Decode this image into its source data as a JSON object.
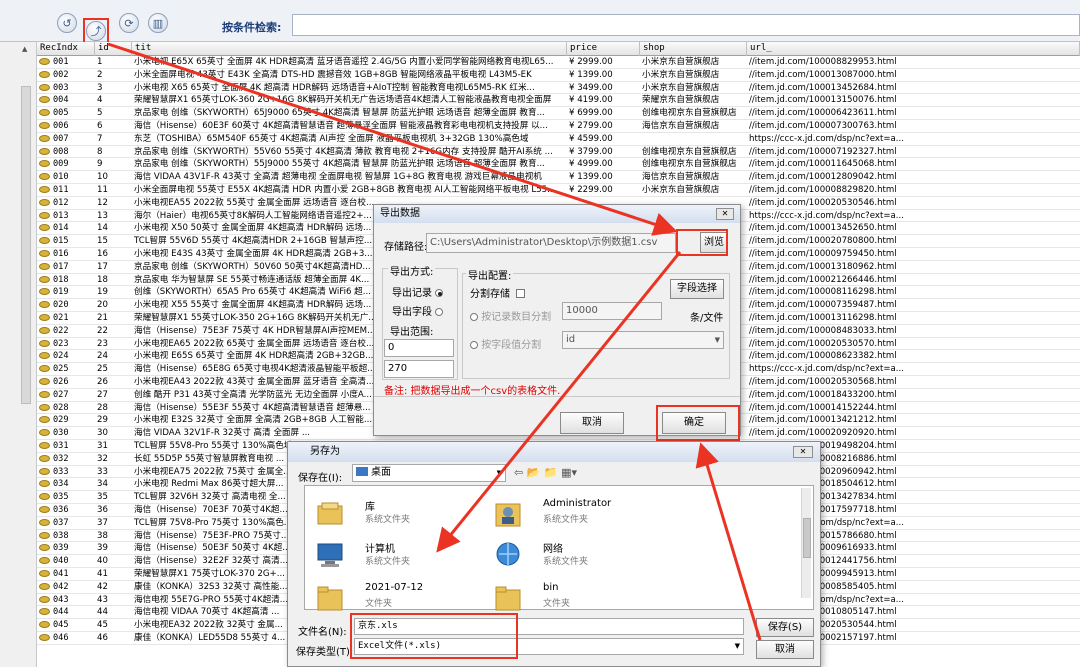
{
  "toolbar": {
    "icons": [
      "undo-icon",
      "export-icon",
      "refresh-icon",
      "delete-icon"
    ],
    "search_label": "按条件检索:",
    "search_value": ""
  },
  "grid": {
    "columns": [
      "RecIndx",
      "id",
      "tit",
      "price",
      "shop",
      "url_"
    ],
    "rows": [
      [
        "001",
        "1",
        "小米电视 E65X 65英寸 全面屏 4K HDR超高清 蓝牙语音遥控 2.4G/5G 内置小爱同学智能网络教育电视L65...",
        "¥ 2999.00",
        "小米京东自营旗舰店",
        "//item.jd.com/100008829953.html"
      ],
      [
        "002",
        "2",
        "小米全面屏电视 43英寸 E43K 全高清 DTS-HD 震撼音效 1GB+8GB 智能网络液晶平板电视 L43M5-EK",
        "¥ 1399.00",
        "小米京东自营旗舰店",
        "//item.jd.com/100013087000.html"
      ],
      [
        "003",
        "3",
        "小米电视 X65 65英寸 全面屏 4K 超高清 HDR解码 远场语音+AIoT控制 智能教育电视L65M5-RK 红米...",
        "¥ 3499.00",
        "小米京东自营旗舰店",
        "//item.jd.com/100013452684.html"
      ],
      [
        "004",
        "4",
        "荣耀智慧屏X1 65英寸LOK-360 2G+16G 8K解码开关机无广告远场语音4K超清人工智能液晶教育电视全面屏",
        "¥ 4199.00",
        "荣耀京东自营旗舰店",
        "//item.jd.com/100013150076.html"
      ],
      [
        "005",
        "5",
        "京品家电 创维（SKYWORTH）65J9000 65英寸 4K超高清 智慧屏 防蓝光护眼 远场语音 超薄全面屏 教育...",
        "¥ 6999.00",
        "创维电视京东自营旗舰店",
        "//item.jd.com/100006423611.html"
      ],
      [
        "006",
        "6",
        "海信（Hisense）60E3F 60英寸 4K超高清智慧语音 超薄悬浮全面屏 智能液晶教育彩电电视机支持投屏 以...",
        "¥ 2799.00",
        "海信京东自营旗舰店",
        "//item.jd.com/100007300763.html"
      ],
      [
        "007",
        "7",
        "东芝（TOSHIBA）65M540F 65英寸 4K超高清 AI声控 全面屏 液晶平板电视机 3+32GB 130%高色域",
        "¥ 4599.00",
        "",
        "https://ccc-x.jd.com/dsp/nc?ext=a..."
      ],
      [
        "008",
        "8",
        "京品家电 创维（SKYWORTH）55V60 55英寸 4K超高清 薄款 教育电视 2+16G内存 支持投屏 酷开AI系统 ...",
        "¥ 3799.00",
        "创维电视京东自营旗舰店",
        "//item.jd.com/100007192327.html"
      ],
      [
        "009",
        "9",
        "京品家电 创维（SKYWORTH）55J9000 55英寸 4K超高清 智慧屏 防蓝光护眼 远场语音 超薄全面屏 教育...",
        "¥ 4999.00",
        "创维电视京东自营旗舰店",
        "//item.jd.com/100011645068.html"
      ],
      [
        "010",
        "10",
        "海信 VIDAA 43V1F-R 43英寸 全高清 超薄电视 全面屏电视 智慧屏 1G+8G 教育电视 游戏巨幕液晶电视机",
        "¥ 1399.00",
        "海信京东自营旗舰店",
        "//item.jd.com/100012809042.html"
      ],
      [
        "011",
        "11",
        "小米全面屏电视 55英寸 E55X 4K超高清 HDR 内置小爱 2GB+8GB 教育电视 AI人工智能网络平板电视 L55...",
        "¥ 2299.00",
        "小米京东自营旗舰店",
        "//item.jd.com/100008829820.html"
      ],
      [
        "012",
        "12",
        "小米电视EA55 2022款 55英寸 金属全面屏 远场语音 逐台校...",
        "",
        "",
        "//item.jd.com/100020530546.html"
      ],
      [
        "013",
        "13",
        "海尔（Haier）电视65英寸8K解码人工智能网络语音遥控2+...",
        "",
        "",
        "https://ccc-x.jd.com/dsp/nc?ext=a..."
      ],
      [
        "014",
        "14",
        "小米电视 X50 50英寸 金属全面屏 4K超高清 HDR解码 远场...",
        "",
        "",
        "//item.jd.com/100013452650.html"
      ],
      [
        "015",
        "15",
        "TCL智屏 55V6D 55英寸 4K超高清HDR 2+16GB 智慧声控...",
        "",
        "",
        "//item.jd.com/100020780800.html"
      ],
      [
        "016",
        "16",
        "小米电视 E43S 43英寸 金属全面屏 4K HDR超高清 2GB+3...",
        "",
        "",
        "//item.jd.com/100009759450.html"
      ],
      [
        "017",
        "17",
        "京品家电 创维（SKYWORTH）50V60 50英寸4K超高清HD...",
        "",
        "",
        "//item.jd.com/100013180962.html"
      ],
      [
        "018",
        "18",
        "京品家电 华为智慧屏 SE 55英寸畅连通话版 超薄全面屏 4K...",
        "",
        "",
        "//item.jd.com/100021266446.html"
      ],
      [
        "019",
        "19",
        "创维（SKYWORTH）65A5 Pro 65英寸 4K超高清 WiFi6 超...",
        "",
        "",
        "//item.jd.com/100008116298.html"
      ],
      [
        "020",
        "20",
        "小米电视 X55 55英寸 金属全面屏 4K超高清 HDR解码 远场...",
        "",
        "",
        "//item.jd.com/100007359487.html"
      ],
      [
        "021",
        "21",
        "荣耀智慧屏X1 55英寸LOK-350 2G+16G 8K解码开关机无广...",
        "",
        "",
        "//item.jd.com/100013116298.html"
      ],
      [
        "022",
        "22",
        "海信（Hisense）75E3F 75英寸 4K HDR智慧屏AI声控MEM...",
        "",
        "",
        "//item.jd.com/100008483033.html"
      ],
      [
        "023",
        "23",
        "小米电视EA65 2022款 65英寸 金属全面屏 远场语音 逐台校...",
        "",
        "",
        "//item.jd.com/100020530570.html"
      ],
      [
        "024",
        "24",
        "小米电视 E65S 65英寸 全面屏 4K HDR超高清 2GB+32GB...",
        "",
        "",
        "//item.jd.com/100008623382.html"
      ],
      [
        "025",
        "25",
        "海信（Hisense）65E8G 65英寸电视4K超清液晶智能平板超...",
        "",
        "",
        "https://ccc-x.jd.com/dsp/nc?ext=a..."
      ],
      [
        "026",
        "26",
        "小米电视EA43 2022款 43英寸 金属全面屏 蓝牙语音 全高清...",
        "",
        "",
        "//item.jd.com/100020530568.html"
      ],
      [
        "027",
        "27",
        "创维 酷开 P31 43英寸全高清 光学防蓝光 无边全面屏 小度A...",
        "",
        "",
        "//item.jd.com/100018433200.html"
      ],
      [
        "028",
        "28",
        "海信（Hisense）55E3F 55英寸 4K超高清智慧语音 超薄悬...",
        "",
        "",
        "//item.jd.com/100014152244.html"
      ],
      [
        "029",
        "29",
        "小米电视 E32S 32英寸 全面屏 全高清 2GB+8GB 人工智能...",
        "",
        "",
        "//item.jd.com/100013421212.html"
      ],
      [
        "030",
        "30",
        "海信 VIDAA 32V1F-R 32英寸 高清 全面屏 ...",
        "",
        "",
        "//item.jd.com/100020920920.html"
      ],
      [
        "031",
        "31",
        "TCL智屏 55V8-Pro 55英寸 130%高色域...",
        "",
        "",
        "//item.jd.com/100019498204.html"
      ],
      [
        "032",
        "32",
        "长虹 55D5P 55英寸智慧屏教育电视 ...",
        "",
        "",
        "//item.jd.com/100008216886.html"
      ],
      [
        "033",
        "33",
        "小米电视EA75 2022款 75英寸 金属全...",
        "",
        "",
        "//item.jd.com/100020960942.html"
      ],
      [
        "034",
        "34",
        "小米电视 Redmi Max 86英寸超大屏...",
        "",
        "",
        "//item.jd.com/100018504612.html"
      ],
      [
        "035",
        "35",
        "TCL智屏 32V6H 32英寸 高清电视 全...",
        "",
        "",
        "//item.jd.com/100013427834.html"
      ],
      [
        "036",
        "36",
        "海信（Hisense）70E3F 70英寸4K超...",
        "",
        "",
        "//item.jd.com/100017597718.html"
      ],
      [
        "037",
        "37",
        "TCL智屏 75V8-Pro 75英寸 130%高色...",
        "",
        "",
        "https://ccc-x.jd.com/dsp/nc?ext=a..."
      ],
      [
        "038",
        "38",
        "海信（Hisense）75E3F-PRO 75英寸...",
        "",
        "",
        "//item.jd.com/100015786680.html"
      ],
      [
        "039",
        "39",
        "海信（Hisense）50E3F 50英寸 4K超...",
        "",
        "",
        "//item.jd.com/100009616933.html"
      ],
      [
        "040",
        "40",
        "海信（Hisense）32E2F 32英寸 高清...",
        "",
        "",
        "//item.jd.com/100012441756.html"
      ],
      [
        "041",
        "41",
        "荣耀智慧屏X1 75英寸LOK-370 2G+...",
        "",
        "",
        "//item.jd.com/100009945913.html"
      ],
      [
        "042",
        "42",
        "康佳（KONKA）32S3 32英寸 高性能...",
        "",
        "",
        "//item.jd.com/100008585405.html"
      ],
      [
        "043",
        "43",
        "海信电视 55E7G-PRO 55英寸4K超清...",
        "",
        "",
        "https://ccc-x.jd.com/dsp/nc?ext=a..."
      ],
      [
        "044",
        "44",
        "海信电视 VIDAA 70英寸 4K超高清 ...",
        "",
        "",
        "//item.jd.com/100010805147.html"
      ],
      [
        "045",
        "45",
        "小米电视EA32 2022款 32英寸 金属...",
        "",
        "",
        "//item.jd.com/100020530544.html"
      ],
      [
        "046",
        "46",
        "康佳（KONKA）LED55D8 55英寸 4...",
        "",
        "",
        "//item.jd.com/100002157197.html"
      ]
    ]
  },
  "export_dialog": {
    "title": "导出数据",
    "close": "✕",
    "path_label": "存储路径:",
    "path_value": "C:\\Users\\Administrator\\Desktop\\示例数据1.csv",
    "browse_label": "浏览",
    "method_title": "导出方式:",
    "method_record": "导出记录",
    "method_field": "导出字段",
    "range_title": "导出范围:",
    "range_from": "0",
    "range_to": "270",
    "config_title": "导出配置:",
    "split_label": "分割存储",
    "field_select": "字段选择",
    "by_count": "按记录数目分割",
    "count_value": "10000",
    "count_unit": "条/文件",
    "by_field": "按字段值分割",
    "field_value": "id",
    "note": "备注: 把数据导出成一个csv的表格文件.",
    "cancel_label": "取消",
    "ok_label": "确定"
  },
  "save_dialog": {
    "title": "另存为",
    "close": "✕",
    "save_in_label": "保存在(I):",
    "save_in_value": "桌面",
    "items": [
      {
        "name": "库",
        "sub": "系统文件夹",
        "icon": "library-folder-icon"
      },
      {
        "name": "Administrator",
        "sub": "系统文件夹",
        "icon": "user-folder-icon"
      },
      {
        "name": "计算机",
        "sub": "系统文件夹",
        "icon": "computer-icon"
      },
      {
        "name": "网络",
        "sub": "系统文件夹",
        "icon": "network-icon"
      },
      {
        "name": "2021-07-12",
        "sub": "文件夹",
        "icon": "folder-icon"
      },
      {
        "name": "bin",
        "sub": "文件夹",
        "icon": "folder-icon"
      }
    ],
    "filename_label": "文件名(N):",
    "filename_value": "京东.xls",
    "filetype_label": "保存类型(T):",
    "filetype_value": "Excel文件(*.xls)",
    "save_label": "保存(S)",
    "cancel_label": "取消"
  },
  "colors": {
    "highlight": "#ea3323",
    "title_bar": "#d4deee",
    "toolbar_bg": "#eef1f6"
  }
}
